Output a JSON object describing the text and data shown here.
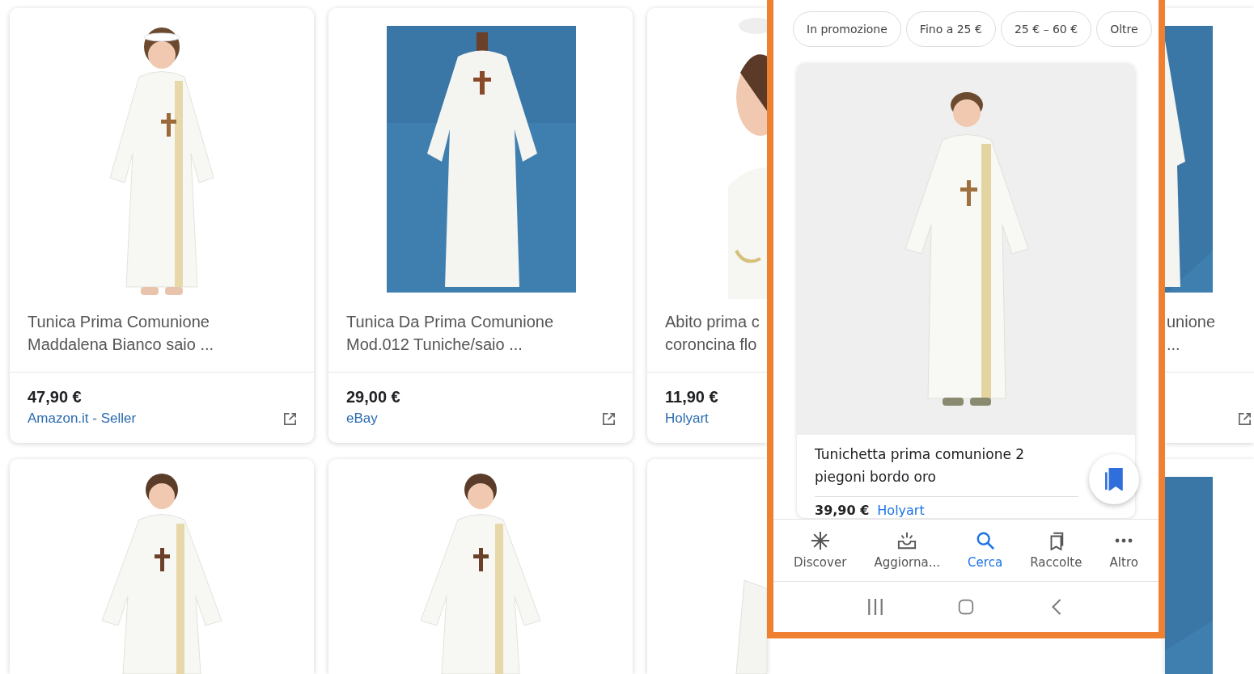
{
  "results": [
    {
      "kind": "full",
      "title_lines": [
        "Tunica Prima Comunione",
        "Maddalena Bianco saio ..."
      ],
      "price": "47,90 €",
      "seller": "Amazon.it - Seller"
    },
    {
      "kind": "full",
      "title_lines": [
        "Tunica Da Prima Comunione",
        "Mod.012 Tuniche/saio ..."
      ],
      "price": "29,00 €",
      "seller": "eBay"
    },
    {
      "kind": "cut_right",
      "title_lines": [
        "Abito prima c",
        "coroncina flo"
      ],
      "price": "11,90 €",
      "seller": "Holyart"
    },
    {
      "kind": "cut_left",
      "title_lines": [
        "unione",
        "..."
      ]
    }
  ],
  "phone": {
    "filter_chips": [
      "In promozione",
      "Fino a 25 €",
      "25 € – 60 €",
      "Oltre"
    ],
    "product": {
      "title": "Tunichetta prima comunione 2 piegoni bordo oro",
      "price": "39,90 €",
      "seller": "Holyart",
      "saved": true
    },
    "bottom_nav": [
      {
        "label": "Discover",
        "selected": false
      },
      {
        "label": "Aggiorna...",
        "selected": false
      },
      {
        "label": "Cerca",
        "selected": true
      },
      {
        "label": "Raccolte",
        "selected": false
      },
      {
        "label": "Altro",
        "selected": false
      }
    ]
  }
}
